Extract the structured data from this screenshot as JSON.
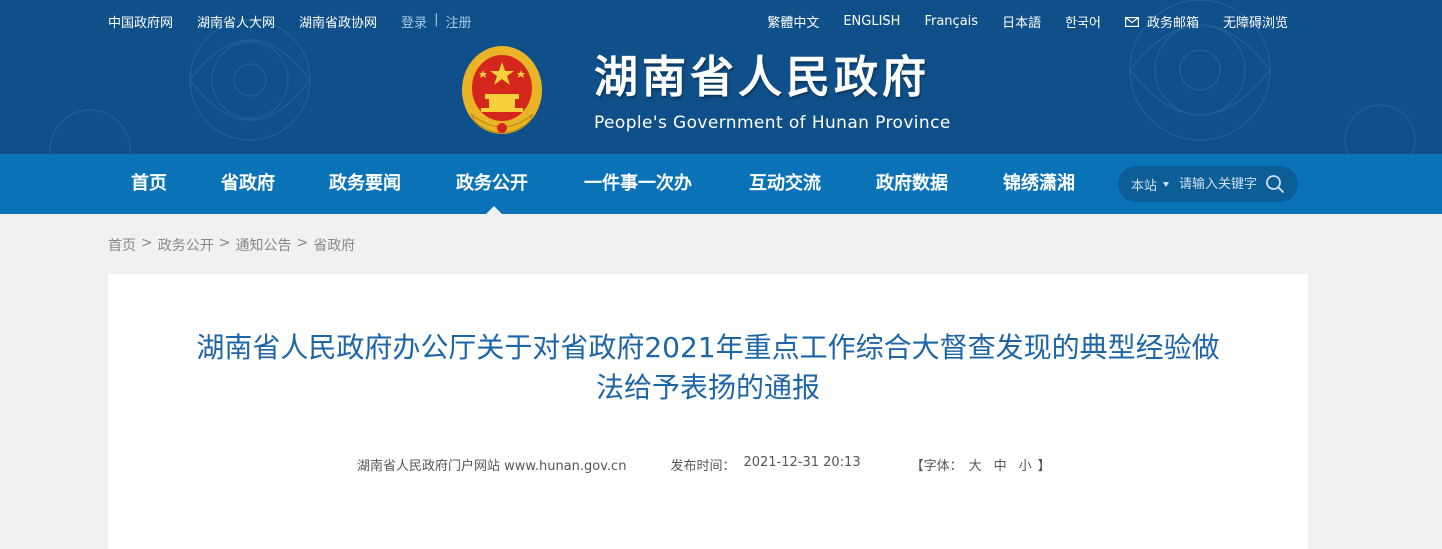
{
  "top_links": {
    "left": [
      "中国政府网",
      "湖南省人大网",
      "湖南省政协网"
    ],
    "login": "登录",
    "separator": "|",
    "register": "注册",
    "right": [
      "繁體中文",
      "ENGLISH",
      "Français",
      "日本語",
      "한국어"
    ],
    "mailbox": "政务邮箱",
    "accessibility": "无障碍浏览"
  },
  "site": {
    "title_cn": "湖南省人民政府",
    "title_en": "People's Government of Hunan Province"
  },
  "nav": {
    "items": [
      "首页",
      "省政府",
      "政务要闻",
      "政务公开",
      "一件事一次办",
      "互动交流",
      "政府数据",
      "锦绣潇湘"
    ],
    "active": "政务公开"
  },
  "search": {
    "scope": "本站",
    "placeholder": "请输入关键字"
  },
  "breadcrumb": {
    "items": [
      "首页",
      "政务公开",
      "通知公告",
      "省政府"
    ],
    "separator": ">"
  },
  "article": {
    "title": "湖南省人民政府办公厅关于对省政府2021年重点工作综合大督查发现的典型经验做法给予表扬的通报",
    "source": "湖南省人民政府门户网站 www.hunan.gov.cn",
    "date_label": "发布时间：",
    "date": "2021-12-31 20:13",
    "font_label": "【字体：",
    "font_large": "大",
    "font_medium": "中",
    "font_small": "小",
    "font_close": "】"
  },
  "colors": {
    "header_bg": "#0f4f8a",
    "nav_bg": "#0a73b8",
    "title_blue": "#1d65a6",
    "page_bg": "#f1f1f1"
  }
}
